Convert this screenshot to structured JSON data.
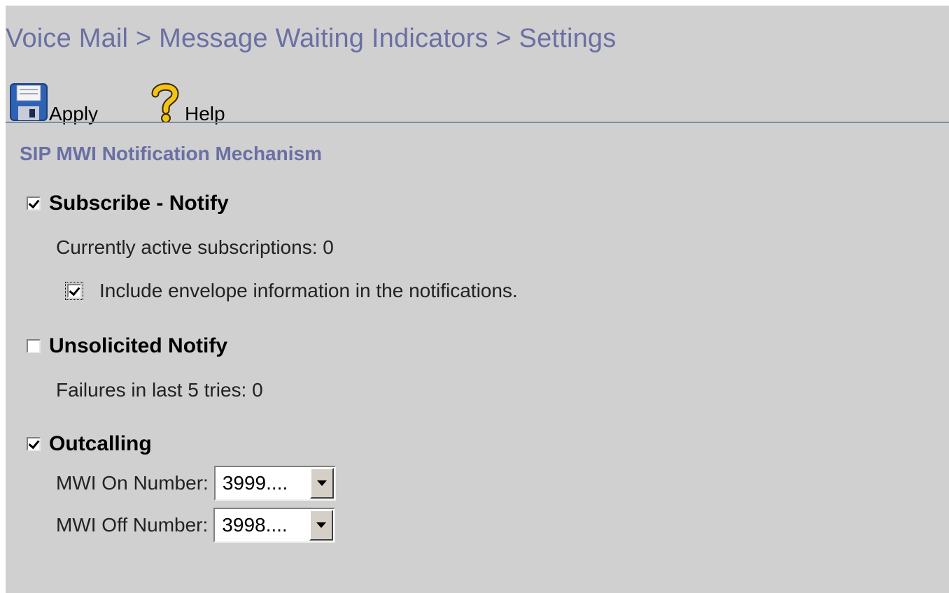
{
  "breadcrumb": "Voice Mail > Message Waiting Indicators > Settings",
  "toolbar": {
    "apply_label": "Apply",
    "help_label": "Help",
    "apply_icon": "floppy-disk-icon",
    "help_icon": "question-mark-icon"
  },
  "section_title": "SIP MWI Notification Mechanism",
  "subscribe_notify": {
    "label": "Subscribe - Notify",
    "checked": true,
    "active_subscriptions": "Currently active subscriptions: 0",
    "include_envelope": {
      "label": "Include envelope information in the notifications.",
      "checked": true
    }
  },
  "unsolicited_notify": {
    "label": "Unsolicited Notify",
    "checked": false,
    "failures": "Failures in last 5 tries: 0"
  },
  "outcalling": {
    "label": "Outcalling",
    "checked": true,
    "mwi_on_label": "MWI On Number:",
    "mwi_on_value": "3999....",
    "mwi_off_label": "MWI Off Number:",
    "mwi_off_value": "3998...."
  },
  "colors": {
    "panel_bg": "#d0d0d0",
    "title_color": "#6a6fa4",
    "divider": "#7a8fa0"
  }
}
